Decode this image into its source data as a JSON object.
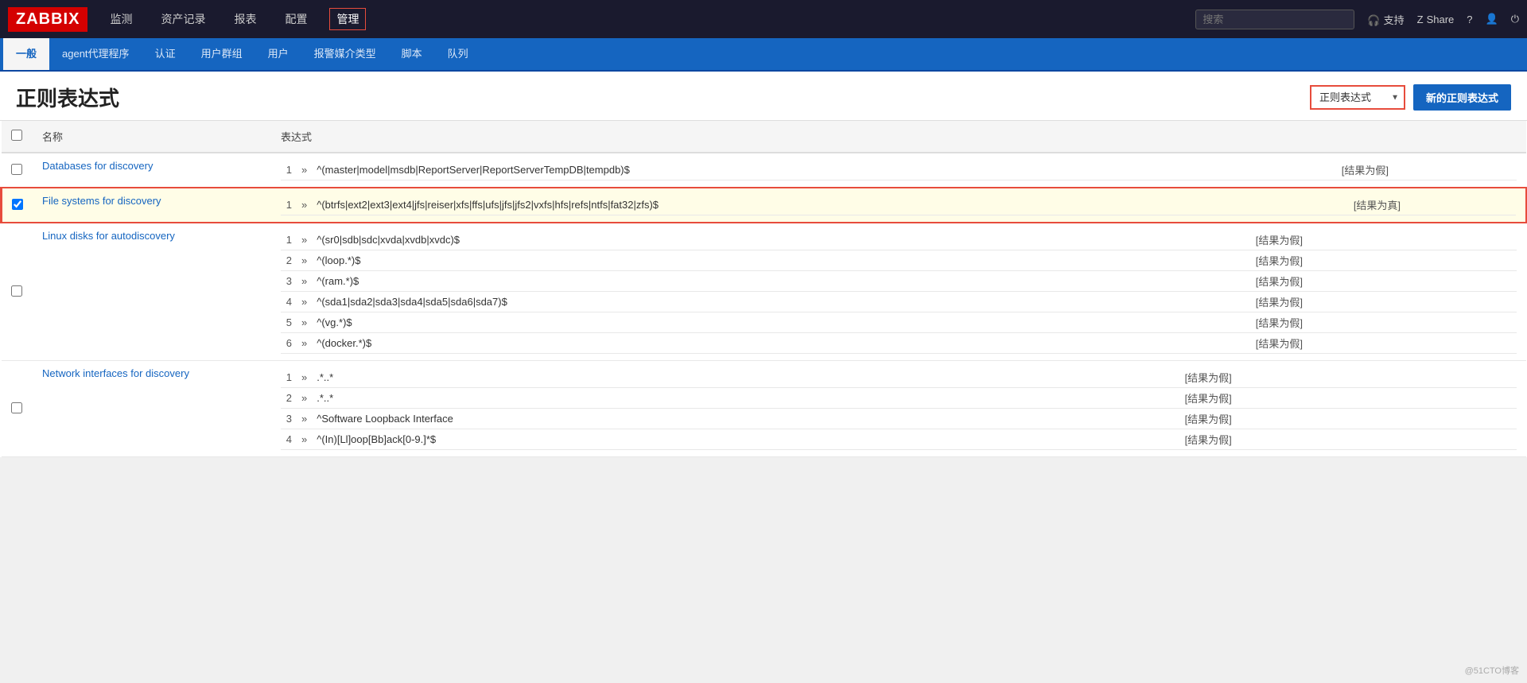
{
  "logo": "ZABBIX",
  "topnav": {
    "items": [
      {
        "label": "监测",
        "active": false
      },
      {
        "label": "资产记录",
        "active": false
      },
      {
        "label": "报表",
        "active": false
      },
      {
        "label": "配置",
        "active": false
      },
      {
        "label": "管理",
        "active": true
      }
    ],
    "search_placeholder": "搜索",
    "support_label": "支持",
    "share_label": "Share"
  },
  "secondnav": {
    "items": [
      {
        "label": "一般",
        "active": true
      },
      {
        "label": "agent代理程序",
        "active": false
      },
      {
        "label": "认证",
        "active": false
      },
      {
        "label": "用户群组",
        "active": false
      },
      {
        "label": "用户",
        "active": false
      },
      {
        "label": "报警媒介类型",
        "active": false
      },
      {
        "label": "脚本",
        "active": false
      },
      {
        "label": "队列",
        "active": false
      }
    ]
  },
  "page": {
    "title": "正则表达式",
    "dropdown_value": "正则表达式",
    "new_button_label": "新的正则表达式"
  },
  "table": {
    "col_name": "名称",
    "col_expr": "达式",
    "col_expr_prefix": "表",
    "rows": [
      {
        "id": "row-databases",
        "name": "Databases for discovery",
        "checked": false,
        "selected": false,
        "expressions": [
          {
            "num": "1",
            "value": "^(master|model|msdb|ReportServer|ReportServerTempDB|tempdb)$",
            "result": "[结果为假]"
          }
        ]
      },
      {
        "id": "row-filesystems",
        "name": "File systems for discovery",
        "checked": true,
        "selected": true,
        "expressions": [
          {
            "num": "1",
            "value": "^(btrfs|ext2|ext3|ext4|jfs|reiser|xfs|ffs|ufs|jfs|jfs2|vxfs|hfs|refs|ntfs|fat32|zfs)$",
            "result": "[结果为真]"
          }
        ]
      },
      {
        "id": "row-linuxdisks",
        "name": "Linux disks for autodiscovery",
        "checked": false,
        "selected": false,
        "expressions": [
          {
            "num": "1",
            "value": "^(sr0|sdb|sdc|xvda|xvdb|xvdc)$",
            "result": "[结果为假]"
          },
          {
            "num": "2",
            "value": "^(loop.*)$",
            "result": "[结果为假]"
          },
          {
            "num": "3",
            "value": "^(ram.*)$",
            "result": "[结果为假]"
          },
          {
            "num": "4",
            "value": "^(sda1|sda2|sda3|sda4|sda5|sda6|sda7)$",
            "result": "[结果为假]"
          },
          {
            "num": "5",
            "value": "^(vg.*)$",
            "result": "[结果为假]"
          },
          {
            "num": "6",
            "value": "^(docker.*)$",
            "result": "[结果为假]"
          }
        ]
      },
      {
        "id": "row-network",
        "name": "Network interfaces for discovery",
        "checked": false,
        "selected": false,
        "expressions": [
          {
            "num": "1",
            "value": ".*..*",
            "result": "[结果为假]"
          },
          {
            "num": "2",
            "value": ".*..*",
            "result": "[结果为假]"
          },
          {
            "num": "3",
            "value": "^Software Loopback Interface",
            "result": "[结果为假]"
          },
          {
            "num": "4",
            "value": "^(In)[Ll]oop[Bb]ack[0-9.]*$",
            "result": "[结果为假]"
          }
        ]
      }
    ]
  },
  "watermark": "@51CTO博客"
}
